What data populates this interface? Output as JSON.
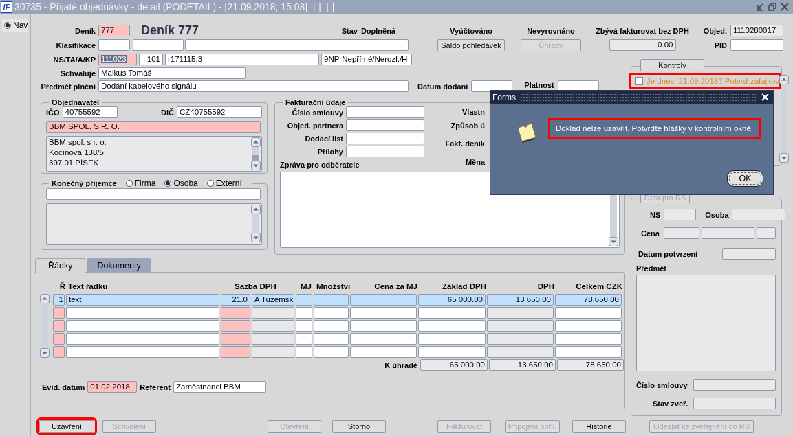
{
  "window": {
    "logo": "iF",
    "title": "30735 - Přijaté objednávky - detail (PODETAIL) - [21.09.2018; 15:08]  [ ]  [ ]"
  },
  "nav": {
    "label": "Nav",
    "selected": true
  },
  "header": {
    "denik": {
      "label": "Deník",
      "value": "777",
      "kind": "required"
    },
    "title": "Deník 777",
    "stav": {
      "label": "Stav",
      "value": "Doplněná"
    },
    "vyuctovano": {
      "label": "Vyúčtováno",
      "button": {
        "label": "Saldo pohledávek",
        "disabled": false
      }
    },
    "nevyrovnano": {
      "label": "Nevyrovnáno",
      "button": {
        "label": "Úhrady",
        "disabled": true
      }
    },
    "zbyva": {
      "label": "Zbývá fakturovat bez DPH",
      "value": "0.00",
      "kind": "readonly"
    },
    "objed": {
      "label": "Objed.",
      "value": "1110280017",
      "kind": "readonly"
    },
    "pid": {
      "label": "PID"
    },
    "klasifikace": {
      "label": "Klasifikace"
    },
    "ns": {
      "label": "NS/TA/A/KP",
      "fields": [
        {
          "value": "111023",
          "kind": "required",
          "text_selected": true
        },
        {
          "value": "101"
        },
        {
          "value": "r171115.3"
        },
        {
          "value": "9NP-Nepřímé/Nerozl./H"
        }
      ]
    },
    "schvaluje": {
      "label": "Schvaluje",
      "value": "Malkus Tomáš"
    },
    "predmet": {
      "label": "Předmět plnění",
      "value": "Dodání kabelového signálu"
    },
    "datum_dodani": {
      "label": "Datum dodání"
    },
    "platnost": {
      "label": "Platnost"
    }
  },
  "objednavatel": {
    "title": "Objednavatel",
    "ico": {
      "label": "IČO",
      "value": "40755592"
    },
    "dic": {
      "label": "DIČ",
      "value": "CZ40755592"
    },
    "name": {
      "value": "BBM SPOL. S R. O.",
      "kind": "required"
    },
    "address": [
      "BBM spol. s r. o.",
      "Kocínova 138/5",
      "397 01  PÍSEK"
    ]
  },
  "konecny": {
    "title": "Konečný příjemce",
    "options": [
      {
        "label": "Firma",
        "selected": false
      },
      {
        "label": "Osoba",
        "selected": true
      },
      {
        "label": "Externí",
        "selected": false
      }
    ]
  },
  "fakturacni": {
    "title": "Fakturační údaje",
    "fields": [
      {
        "label": "Číslo smlouvy"
      },
      {
        "label": "Objed. partnera"
      },
      {
        "label": "Dodací list"
      },
      {
        "label": "Přílohy"
      }
    ],
    "side_labels": [
      "Vlastn",
      "Způsob ú",
      "Fakt. deník"
    ],
    "mena": "Měna",
    "zprava": "Zpráva pro odběratele"
  },
  "kontroly": {
    "button": "Kontroly",
    "items": [
      {
        "text": "Je dnes: 21.09.2018? Potvrď zafajkov",
        "checked": false,
        "highlighted": true
      }
    ]
  },
  "rs": {
    "button": {
      "label": "Data pro RS",
      "disabled": true
    },
    "kind": "readonly",
    "ns": "NS",
    "osoba": "Osoba",
    "cena": "Cena",
    "datum": "Datum potvrzení",
    "predmet": "Předmět",
    "cislo": "Číslo smlouvy",
    "stav": "Stav zveř."
  },
  "tabs": [
    {
      "label": "Řádky",
      "selected": true
    },
    {
      "label": "Dokumenty",
      "selected": false
    }
  ],
  "table": {
    "columns": [
      {
        "label": "Ř",
        "kind": "required"
      },
      {
        "label": "Text řádku"
      },
      {
        "label": "Sazba DPH",
        "kind": "required"
      },
      {
        "kind": "readonly"
      },
      {
        "label": "MJ"
      },
      {
        "label": "Množství"
      },
      {
        "label": "Cena za MJ"
      },
      {
        "label": "Základ DPH"
      },
      {
        "label": "DPH",
        "kind": "readonly"
      },
      {
        "label": "Celkem  CZK"
      }
    ],
    "rows": [
      {
        "selected": true,
        "cells": [
          "1",
          "text",
          "21.0",
          "A  Tuzemsk",
          null,
          null,
          null,
          "65 000.00",
          "13 650.00",
          "78 650.00"
        ]
      },
      {
        "selected": false
      },
      {
        "selected": false
      },
      {
        "selected": false
      },
      {
        "selected": false
      }
    ],
    "totals": {
      "label": "K úhradě",
      "values": [
        "65 000.00",
        "13 650.00",
        "78 650.00"
      ]
    }
  },
  "evid": {
    "label": "Evid. datum",
    "value": "01.02.2018",
    "kind": "required"
  },
  "referent": {
    "label": "Referent",
    "value": "Zaměstnanci BBM"
  },
  "buttons": [
    {
      "label": "Uzavření",
      "disabled": false,
      "highlighted": true
    },
    {
      "label": "Schválení",
      "disabled": true,
      "highlighted": false
    },
    {
      "label": "Otevření",
      "disabled": true,
      "highlighted": false
    },
    {
      "label": "Storno",
      "disabled": false,
      "highlighted": false
    },
    {
      "label": "Fakturovat",
      "disabled": true,
      "highlighted": false
    },
    {
      "label": "Připojení pohl.",
      "disabled": true,
      "highlighted": false
    },
    {
      "label": "Historie",
      "disabled": false,
      "highlighted": false
    },
    {
      "label": "Odeslat ke zveřejnění do RS",
      "disabled": true,
      "highlighted": false
    }
  ],
  "dialog": {
    "title": "Forms",
    "message": "Doklad nelze uzavřít. Potvrďte hlášky v kontrolním okně.",
    "highlighted": true,
    "ok": "OK"
  }
}
